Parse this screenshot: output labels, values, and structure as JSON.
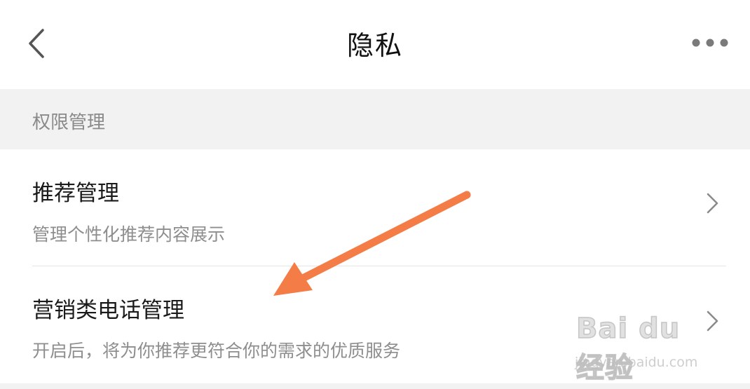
{
  "header": {
    "title": "隐私",
    "back_icon": "chevron-left-icon",
    "more_icon": "more-horizontal-icon"
  },
  "section": {
    "label": "权限管理"
  },
  "rows": [
    {
      "title": "推荐管理",
      "subtitle": "管理个性化推荐内容展示",
      "icon": "chevron-right-icon"
    },
    {
      "title": "营销类电话管理",
      "subtitle": "开启后，将为你推荐更符合你的需求的优质服务",
      "icon": "chevron-right-icon"
    }
  ],
  "annotation": {
    "arrow_color": "#f47c46"
  },
  "watermark": {
    "logo": "Bai du 经验",
    "url": "jingyan.baidu.com"
  },
  "colors": {
    "section_bg": "#f2f2f2",
    "title_text": "#111111",
    "secondary_text": "#8e8e8e"
  }
}
